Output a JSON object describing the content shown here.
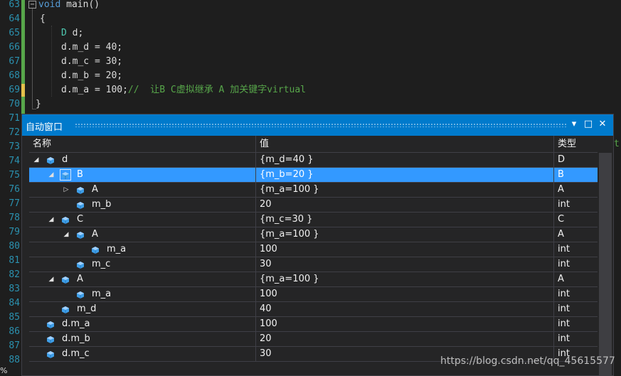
{
  "editor": {
    "line_numbers": [
      "63",
      "64",
      "65",
      "66",
      "67",
      "68",
      "69",
      "70",
      "71",
      "72",
      "73",
      "74",
      "75",
      "76",
      "77",
      "78",
      "79",
      "80",
      "81",
      "82",
      "83",
      "84",
      "85",
      "86",
      "87",
      "88"
    ],
    "lines": [
      {
        "kw": "void",
        "rest": " main()"
      },
      {
        "text": "{"
      },
      {
        "type": "D",
        "rest": " d;"
      },
      {
        "text": "d.m_d = 40;"
      },
      {
        "text": "d.m_c = 30;"
      },
      {
        "text": "d.m_b = 20;"
      },
      {
        "text": "d.m_a = 100;",
        "comment": "//  让B C虚拟继承 A 加关键字virtual"
      },
      {
        "text": "}"
      }
    ],
    "clipped_text": "t"
  },
  "autos": {
    "title": "自动窗口",
    "buttons": {
      "dropdown": "▾",
      "maximize": "□",
      "close": "✕"
    },
    "columns": {
      "name": "名称",
      "value": "值",
      "type": "类型"
    },
    "rows": [
      {
        "name": "d",
        "value": "{m_d=40 }",
        "type": "D",
        "depth": 0,
        "expander": "expanded"
      },
      {
        "name": "B",
        "value": "{m_b=20 }",
        "type": "B",
        "depth": 1,
        "expander": "expanded",
        "selected": true
      },
      {
        "name": "A",
        "value": "{m_a=100 }",
        "type": "A",
        "depth": 2,
        "expander": "collapsed"
      },
      {
        "name": "m_b",
        "value": "20",
        "type": "int",
        "depth": 2,
        "expander": "none"
      },
      {
        "name": "C",
        "value": "{m_c=30 }",
        "type": "C",
        "depth": 1,
        "expander": "expanded"
      },
      {
        "name": "A",
        "value": "{m_a=100 }",
        "type": "A",
        "depth": 2,
        "expander": "expanded"
      },
      {
        "name": "m_a",
        "value": "100",
        "type": "int",
        "depth": 3,
        "expander": "none"
      },
      {
        "name": "m_c",
        "value": "30",
        "type": "int",
        "depth": 2,
        "expander": "none"
      },
      {
        "name": "A",
        "value": "{m_a=100 }",
        "type": "A",
        "depth": 1,
        "expander": "expanded"
      },
      {
        "name": "m_a",
        "value": "100",
        "type": "int",
        "depth": 2,
        "expander": "none"
      },
      {
        "name": "m_d",
        "value": "40",
        "type": "int",
        "depth": 1,
        "expander": "none"
      },
      {
        "name": "d.m_a",
        "value": "100",
        "type": "int",
        "depth": 0,
        "expander": "none"
      },
      {
        "name": "d.m_b",
        "value": "20",
        "type": "int",
        "depth": 0,
        "expander": "none"
      },
      {
        "name": "d.m_c",
        "value": "30",
        "type": "int",
        "depth": 0,
        "expander": "none"
      }
    ]
  },
  "status": {
    "zoom_fragment": "%"
  },
  "watermark": "https://blog.csdn.net/qq_45615577",
  "colors": {
    "accent": "#007acc",
    "selection": "#3399ff",
    "cube": "#3f9fe8",
    "editor_bg": "#1e1e1e"
  }
}
